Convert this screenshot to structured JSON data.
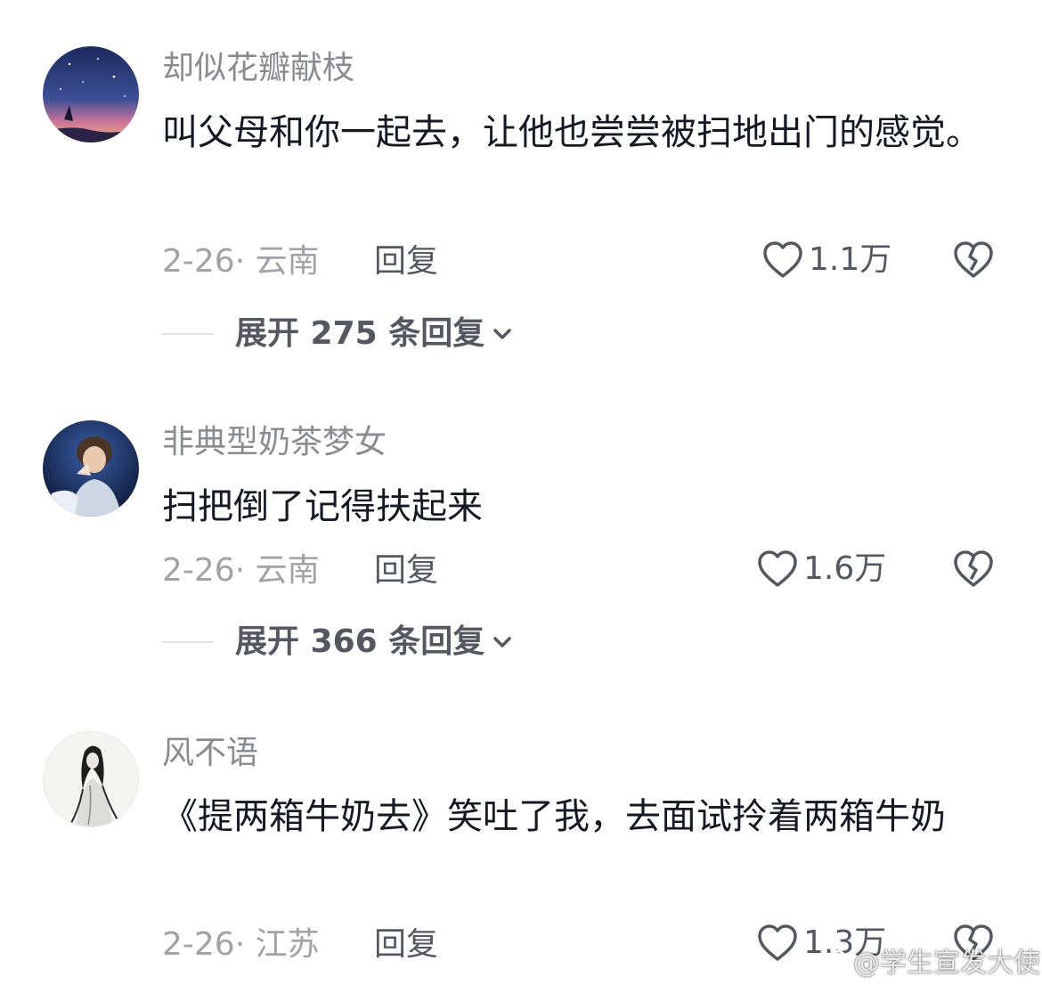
{
  "comments": [
    {
      "username": "却似花瓣献枝",
      "content": "叫父母和你一起去，让他也尝尝被扫地出门的感觉。",
      "meta": "2-26· 云南",
      "reply_label": "回复",
      "likes": "1.1万",
      "expand_label": "展开 275 条回复",
      "avatar_icon": "night-sky-avatar"
    },
    {
      "username": "非典型奶茶梦女",
      "content": "扫把倒了记得扶起来",
      "meta": "2-26· 云南",
      "reply_label": "回复",
      "likes": "1.6万",
      "expand_label": "展开 366 条回复",
      "avatar_icon": "performer-avatar"
    },
    {
      "username": "风不语",
      "content": "《提两箱牛奶去》笑吐了我，去面试拎着两箱牛奶",
      "meta": "2-26· 江苏",
      "reply_label": "回复",
      "likes": "1.3万",
      "avatar_icon": "ink-figure-avatar"
    }
  ],
  "watermark": {
    "text": "@学生宣发大使",
    "icon": "weibo-logo-icon"
  },
  "colors": {
    "text_primary": "#161823",
    "text_secondary": "#8a8b91",
    "text_action": "#565861"
  }
}
